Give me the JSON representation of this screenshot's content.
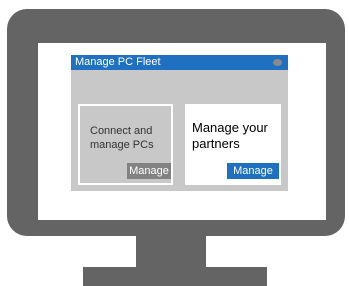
{
  "window": {
    "title": "Manage PC Fleet"
  },
  "cards": [
    {
      "text": "Connect and manage PCs",
      "button_label": "Manage"
    },
    {
      "text": "Manage your partners",
      "button_label": "Manage"
    }
  ],
  "colors": {
    "monitor": "#646464",
    "accent": "#1f70c1",
    "window_background": "#c8c8c8",
    "secondary_button": "#828282"
  }
}
